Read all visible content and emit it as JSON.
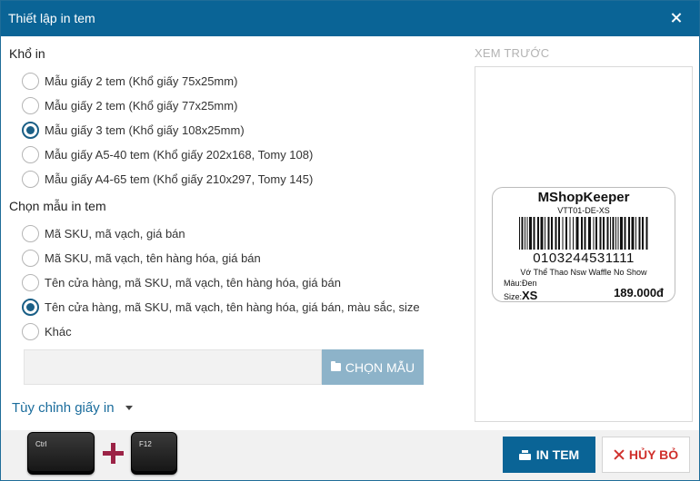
{
  "dialog": {
    "title": "Thiết lập in tem",
    "close_icon": "close-icon"
  },
  "paper_size": {
    "label": "Khổ in",
    "options": [
      {
        "label": "Mẫu giấy 2 tem (Khổ giấy 75x25mm)",
        "checked": false
      },
      {
        "label": "Mẫu giấy 2 tem (Khổ giấy 77x25mm)",
        "checked": false
      },
      {
        "label": "Mẫu giấy 3 tem (Khổ giấy 108x25mm)",
        "checked": true
      },
      {
        "label": "Mẫu giấy A5-40 tem (Khổ giấy 202x168, Tomy 108)",
        "checked": false
      },
      {
        "label": "Mẫu giấy A4-65 tem (Khổ giấy 210x297, Tomy 145)",
        "checked": false
      }
    ]
  },
  "template": {
    "label": "Chọn mẫu in tem",
    "options": [
      {
        "label": "Mã SKU, mã vạch, giá bán",
        "checked": false
      },
      {
        "label": "Mã SKU, mã vạch, tên hàng hóa, giá bán",
        "checked": false
      },
      {
        "label": "Tên cửa hàng, mã SKU, mã vạch, tên hàng hóa, giá bán",
        "checked": false
      },
      {
        "label": "Tên cửa hàng, mã SKU, mã vạch, tên hàng hóa, giá bán, màu sắc, size",
        "checked": true
      },
      {
        "label": "Khác",
        "checked": false
      }
    ],
    "custom_value": "",
    "choose_label": "CHỌN MẪU",
    "choose_icon": "folder-icon"
  },
  "customize_paper": {
    "label": "Tùy chỉnh giấy in",
    "icon": "caret-down-icon"
  },
  "preview": {
    "title": "XEM TRƯỚC",
    "store": "MShopKeeper",
    "sku": "VTT01-DE-XS",
    "barcode": "0103244531111",
    "product": "Vớ Thể Thao Nsw Waffle No Show",
    "color_label": "Màu:",
    "color_value": "Đen",
    "size_label": "Size:",
    "size_value": "XS",
    "price": "189.000đ"
  },
  "shortcut": {
    "key1": "Ctrl",
    "key2": "F12",
    "plus_icon": "plus-icon"
  },
  "actions": {
    "print_label": "IN TEM",
    "print_icon": "printer-icon",
    "cancel_label": "HỦY BỎ",
    "cancel_icon": "close-icon"
  },
  "colors": {
    "primary": "#0a6496",
    "cancel": "#d0312d",
    "plus": "#9b2346"
  }
}
